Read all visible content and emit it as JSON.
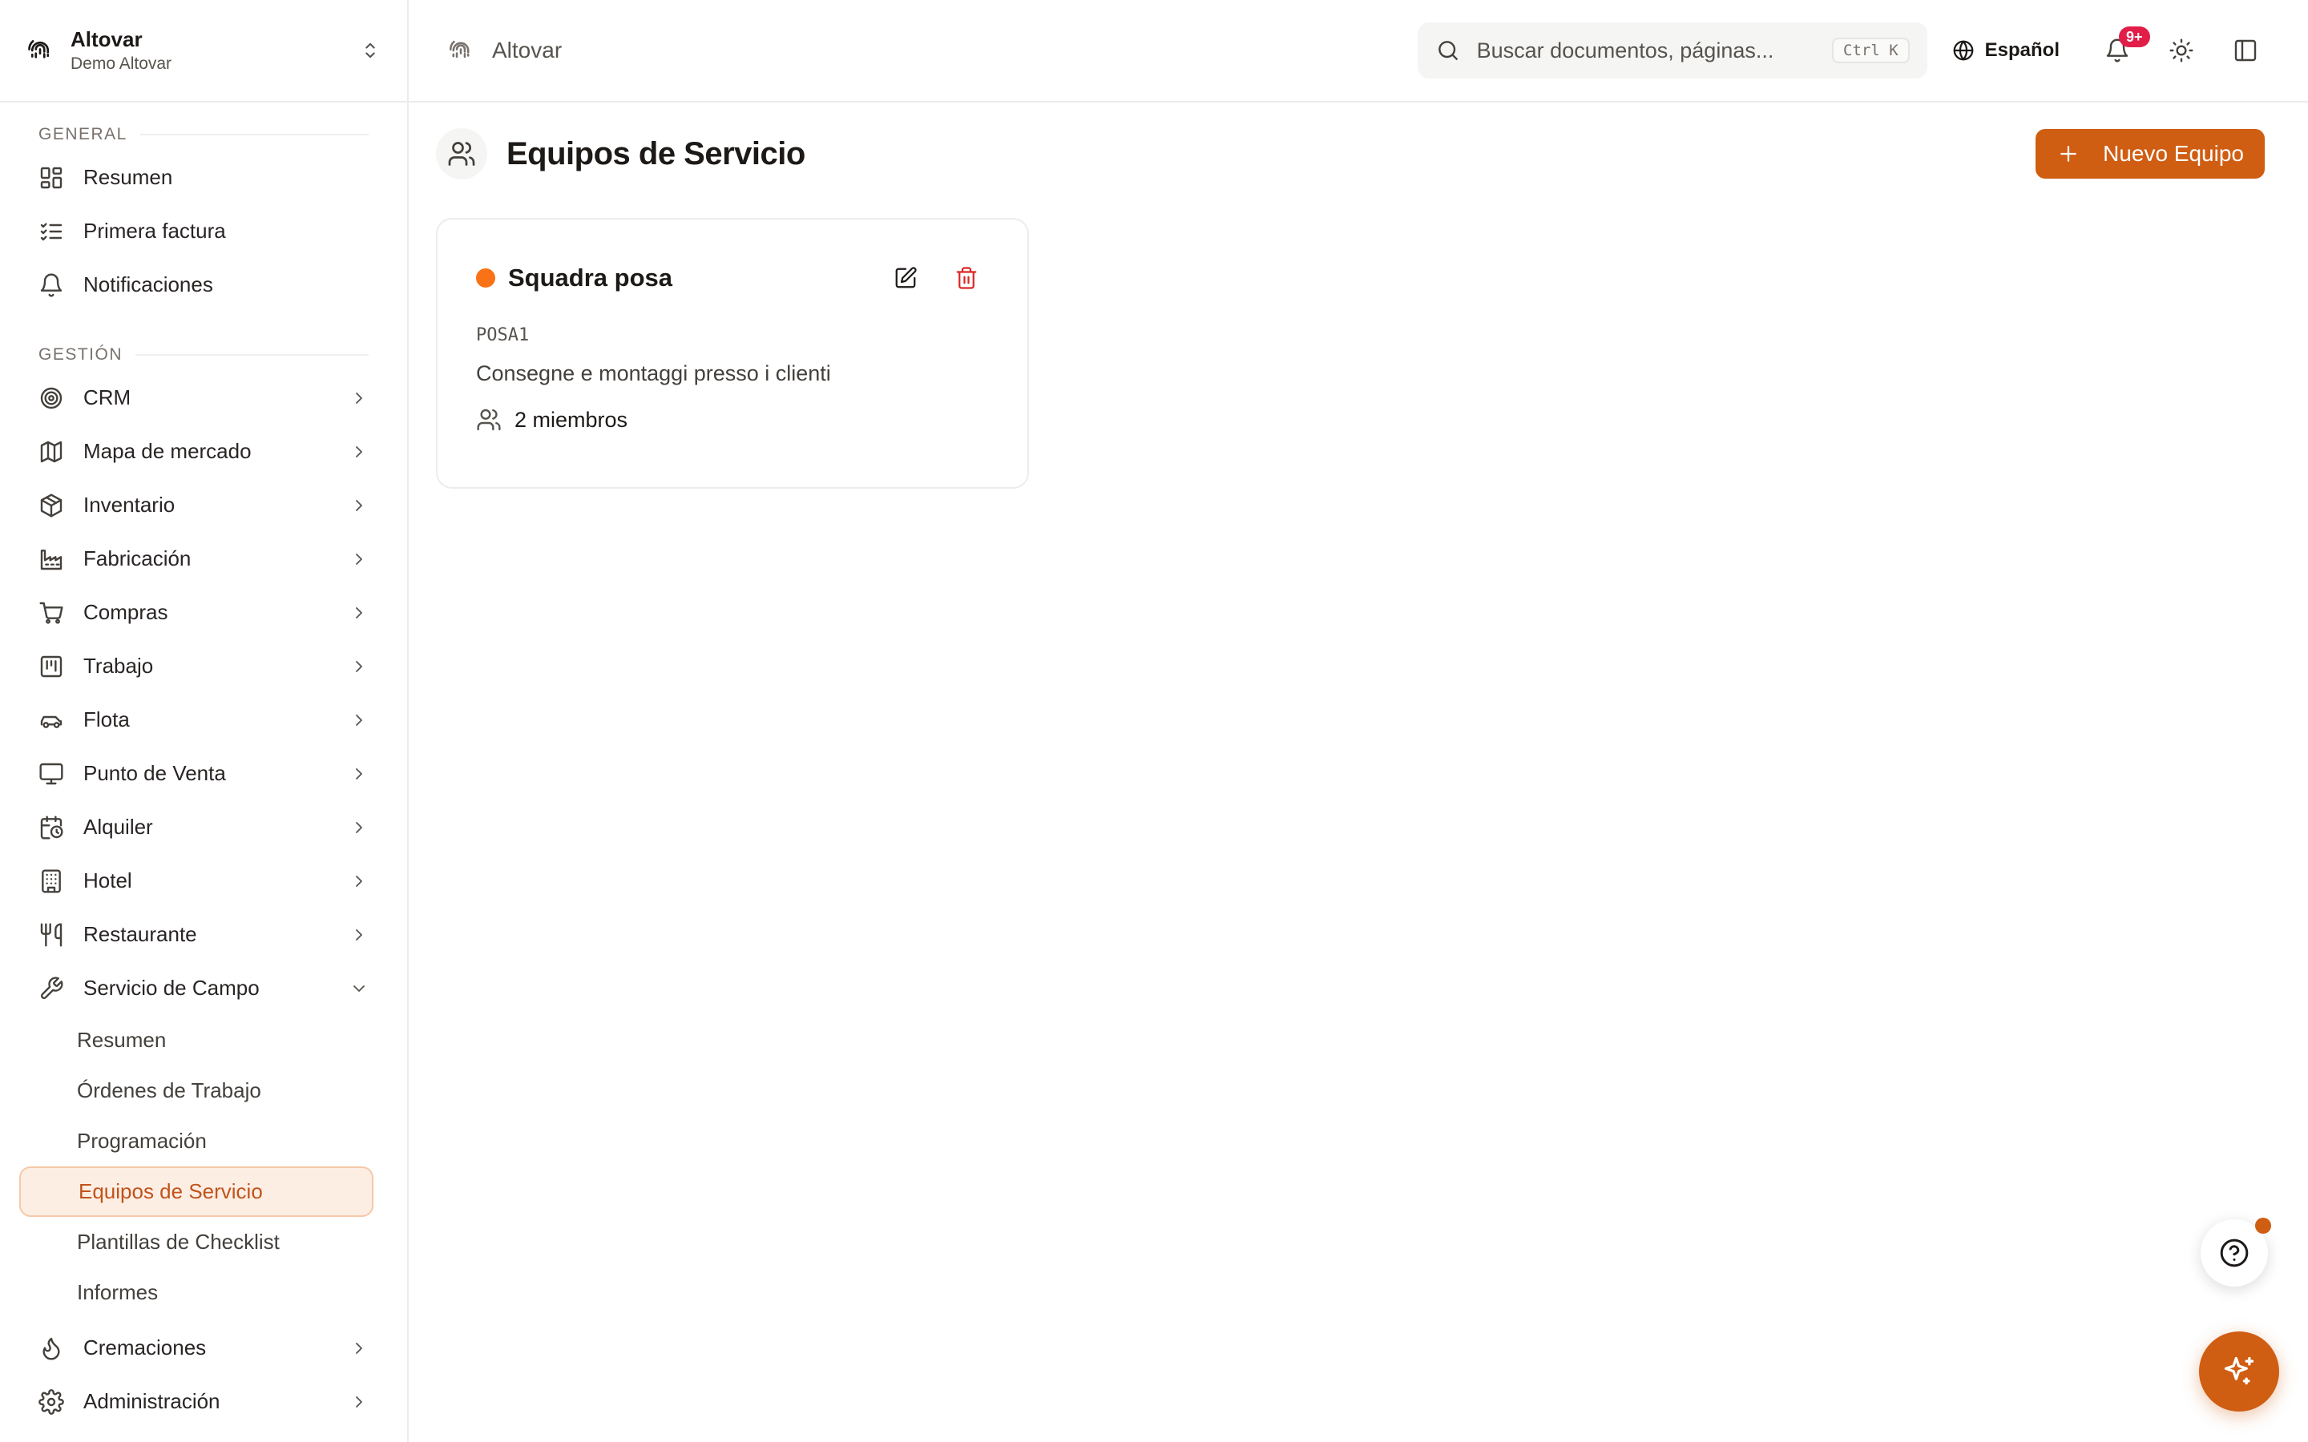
{
  "brand": {
    "org": "Altovar",
    "workspace": "Demo Altovar"
  },
  "topbar": {
    "breadcrumb": "Altovar",
    "search_placeholder": "Buscar documentos, páginas...",
    "search_shortcut": "Ctrl K",
    "language": "Español",
    "notifications_badge": "9+"
  },
  "sidebar": {
    "general_title": "GENERAL",
    "general": [
      {
        "label": "Resumen",
        "icon": "dashboard-icon"
      },
      {
        "label": "Primera factura",
        "icon": "checklist-icon"
      },
      {
        "label": "Notificaciones",
        "icon": "bell-icon"
      }
    ],
    "gestion_title": "GESTIÓN",
    "gestion": [
      {
        "label": "CRM",
        "icon": "target-icon"
      },
      {
        "label": "Mapa de mercado",
        "icon": "map-icon"
      },
      {
        "label": "Inventario",
        "icon": "package-icon"
      },
      {
        "label": "Fabricación",
        "icon": "factory-icon"
      },
      {
        "label": "Compras",
        "icon": "cart-icon"
      },
      {
        "label": "Trabajo",
        "icon": "kanban-icon"
      },
      {
        "label": "Flota",
        "icon": "car-icon"
      },
      {
        "label": "Punto de Venta",
        "icon": "monitor-icon"
      },
      {
        "label": "Alquiler",
        "icon": "calendar-clock-icon"
      },
      {
        "label": "Hotel",
        "icon": "building-icon"
      },
      {
        "label": "Restaurante",
        "icon": "utensils-icon"
      },
      {
        "label": "Servicio de Campo",
        "icon": "wrench-icon"
      }
    ],
    "field_service_sub": [
      "Resumen",
      "Órdenes de Trabajo",
      "Programación",
      "Equipos de Servicio",
      "Plantillas de Checklist",
      "Informes"
    ],
    "field_service_active": "Equipos de Servicio",
    "after": [
      {
        "label": "Cremaciones",
        "icon": "flame-icon"
      },
      {
        "label": "Administración",
        "icon": "gear-icon"
      }
    ]
  },
  "page": {
    "title": "Equipos de Servicio",
    "new_button": "Nuevo Equipo"
  },
  "teams": [
    {
      "name": "Squadra posa",
      "code": "POSA1",
      "description": "Consegne e montaggi presso i clienti",
      "members": "2 miembros",
      "color": "#f97316"
    }
  ],
  "colors": {
    "accent": "#cf5d12",
    "danger": "#dc2626",
    "badge": "#e11d48"
  }
}
